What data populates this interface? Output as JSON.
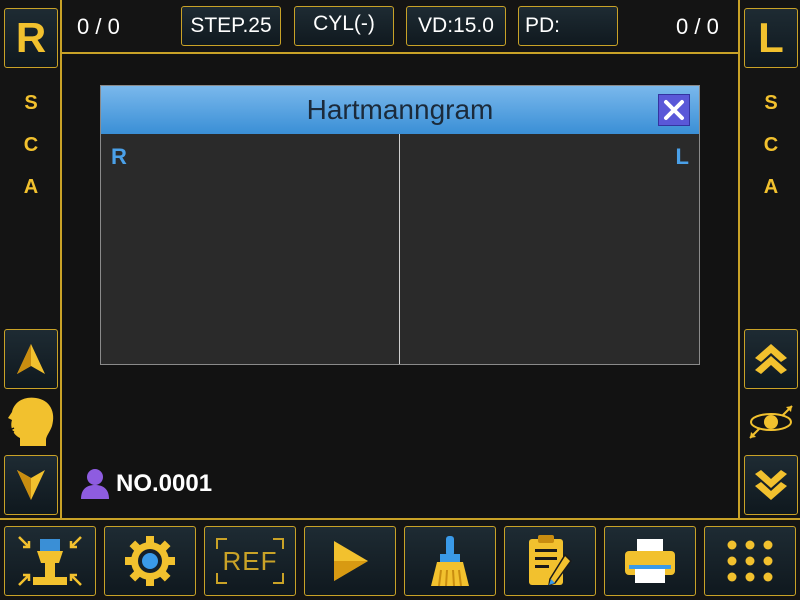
{
  "right_panel": {
    "eye_label": "R",
    "sca": [
      "S",
      "C",
      "A"
    ]
  },
  "left_panel": {
    "eye_label": "L",
    "sca": [
      "S",
      "C",
      "A"
    ]
  },
  "topbar": {
    "left_counter": "0 / 0",
    "step": "STEP.25",
    "cyl": "CYL(-)",
    "vd": "VD:15.0",
    "pd": "PD:",
    "right_counter": "0 / 0"
  },
  "dialog": {
    "title": "Hartmanngram",
    "left_pane_label": "R",
    "right_pane_label": "L"
  },
  "patient": {
    "number": "NO.0001"
  },
  "toolbar": {
    "ref_label": "REF",
    "icons": [
      "auto-align-icon",
      "settings-gear-icon",
      "ref-icon",
      "play-icon",
      "broom-clean-icon",
      "clipboard-edit-icon",
      "printer-icon",
      "menu-grid-icon"
    ]
  },
  "colors": {
    "gold": "#f2c12e",
    "border_gold": "#c9a227",
    "title_blue": "#4a9be0",
    "label_blue": "#4aa0e8",
    "patient_purple": "#8e5ce0"
  }
}
